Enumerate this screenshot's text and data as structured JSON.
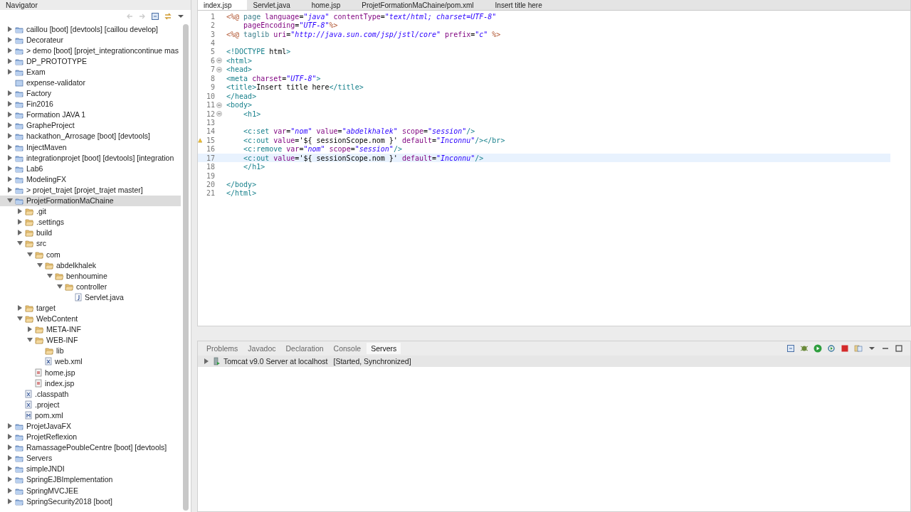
{
  "navigator": {
    "title": "Navigator",
    "tree": [
      {
        "label": "caillou [boot] [devtools] [caillou develop]",
        "kind": "project",
        "expanded": false,
        "selected": false
      },
      {
        "label": "Decorateur",
        "kind": "project",
        "expanded": false,
        "selected": false
      },
      {
        "label": "> demo [boot] [projet_integrationcontinue mas",
        "kind": "project",
        "expanded": false,
        "selected": false
      },
      {
        "label": "DP_PROTOTYPE",
        "kind": "project",
        "expanded": false,
        "selected": false
      },
      {
        "label": "Exam",
        "kind": "project",
        "expanded": false,
        "selected": false
      },
      {
        "label": "expense-validator",
        "kind": "closed",
        "selected": false
      },
      {
        "label": "Factory",
        "kind": "project",
        "expanded": false,
        "selected": false
      },
      {
        "label": "Fin2016",
        "kind": "project",
        "expanded": false,
        "selected": false
      },
      {
        "label": "Formation JAVA 1",
        "kind": "project",
        "expanded": false,
        "selected": false
      },
      {
        "label": "GrapheProject",
        "kind": "project",
        "expanded": false,
        "selected": false
      },
      {
        "label": "hackathon_Arrosage [boot] [devtools]",
        "kind": "project",
        "expanded": false,
        "selected": false
      },
      {
        "label": "InjectMaven",
        "kind": "project",
        "expanded": false,
        "selected": false
      },
      {
        "label": "integrationprojet [boot] [devtools] [integration",
        "kind": "project",
        "expanded": false,
        "selected": false
      },
      {
        "label": "Lab6",
        "kind": "project",
        "expanded": false,
        "selected": false
      },
      {
        "label": "ModelingFX",
        "kind": "project",
        "expanded": false,
        "selected": false
      },
      {
        "label": "> projet_trajet [projet_trajet master]",
        "kind": "project",
        "expanded": false,
        "selected": false
      },
      {
        "label": "ProjetFormationMaChaine",
        "kind": "project",
        "expanded": true,
        "selected": true,
        "children": [
          {
            "label": ".git",
            "kind": "folder",
            "expanded": false,
            "selected": false
          },
          {
            "label": ".settings",
            "kind": "folder",
            "expanded": false,
            "selected": false
          },
          {
            "label": "build",
            "kind": "folder",
            "expanded": false,
            "selected": false
          },
          {
            "label": "src",
            "kind": "folder",
            "expanded": true,
            "selected": false,
            "children": [
              {
                "label": "com",
                "kind": "folder",
                "expanded": true,
                "selected": false,
                "children": [
                  {
                    "label": "abdelkhalek",
                    "kind": "folder",
                    "expanded": true,
                    "selected": false,
                    "children": [
                      {
                        "label": "benhoumine",
                        "kind": "folder",
                        "expanded": true,
                        "selected": false,
                        "children": [
                          {
                            "label": "controller",
                            "kind": "folder",
                            "expanded": true,
                            "selected": false,
                            "children": [
                              {
                                "label": "Servlet.java",
                                "kind": "java",
                                "selected": false
                              }
                            ]
                          }
                        ]
                      }
                    ]
                  }
                ]
              }
            ]
          },
          {
            "label": "target",
            "kind": "folder",
            "expanded": false,
            "selected": false
          },
          {
            "label": "WebContent",
            "kind": "folder",
            "expanded": true,
            "selected": false,
            "children": [
              {
                "label": "META-INF",
                "kind": "folder",
                "expanded": false,
                "selected": false
              },
              {
                "label": "WEB-INF",
                "kind": "folder",
                "expanded": true,
                "selected": false,
                "children": [
                  {
                    "label": "lib",
                    "kind": "folder",
                    "selected": false
                  },
                  {
                    "label": "web.xml",
                    "kind": "xml",
                    "selected": false
                  }
                ]
              },
              {
                "label": "home.jsp",
                "kind": "jsp",
                "selected": false
              },
              {
                "label": "index.jsp",
                "kind": "jsp",
                "selected": false
              }
            ]
          },
          {
            "label": ".classpath",
            "kind": "xml",
            "selected": false
          },
          {
            "label": ".project",
            "kind": "xml",
            "selected": false
          },
          {
            "label": "pom.xml",
            "kind": "maven",
            "selected": false
          }
        ]
      },
      {
        "label": "ProjetJavaFX",
        "kind": "project",
        "expanded": false,
        "selected": false
      },
      {
        "label": "ProjetReflexion",
        "kind": "project",
        "expanded": false,
        "selected": false
      },
      {
        "label": "RamassagePoubleCentre [boot] [devtools]",
        "kind": "project",
        "expanded": false,
        "selected": false
      },
      {
        "label": "Servers",
        "kind": "project",
        "expanded": false,
        "selected": false
      },
      {
        "label": "simpleJNDI",
        "kind": "project",
        "expanded": false,
        "selected": false
      },
      {
        "label": "SpringEJBImplementation",
        "kind": "project",
        "expanded": false,
        "selected": false
      },
      {
        "label": "SpringMVCJEE",
        "kind": "project",
        "expanded": false,
        "selected": false
      },
      {
        "label": "SpringSecurity2018 [boot]",
        "kind": "project",
        "expanded": false,
        "selected": false
      }
    ]
  },
  "editor": {
    "tabs": [
      {
        "label": "index.jsp",
        "selected": true
      },
      {
        "label": "Servlet.java",
        "selected": false
      },
      {
        "label": "home.jsp",
        "selected": false
      },
      {
        "label": "ProjetFormationMaChaine/pom.xml",
        "selected": false
      },
      {
        "label": "Insert title here",
        "selected": false
      }
    ],
    "lines": [
      {
        "number": "1",
        "text": "<%@ page language=\"java\" contentType=\"text/html; charset=UTF-8\""
      },
      {
        "number": "2",
        "text": "    pageEncoding=\"UTF-8\"%>"
      },
      {
        "number": "3",
        "text": "<%@ taglib uri=\"http://java.sun.com/jsp/jstl/core\" prefix=\"c\" %>"
      },
      {
        "number": "4"
      },
      {
        "number": "5",
        "text": "<!DOCTYPE html>"
      },
      {
        "number": "6",
        "fold": true,
        "text": "<html>"
      },
      {
        "number": "7",
        "fold": true,
        "text": "<head>"
      },
      {
        "number": "8",
        "text": "<meta charset=\"UTF-8\">"
      },
      {
        "number": "9",
        "text": "<title>Insert title here</title>"
      },
      {
        "number": "10",
        "text": "</head>"
      },
      {
        "number": "11",
        "fold": true,
        "text": "<body>"
      },
      {
        "number": "12",
        "fold": true,
        "text": "    <h1>"
      },
      {
        "number": "13"
      },
      {
        "number": "14",
        "text": "    <c:set var=\"nom\" value=\"abdelkhalek\" scope=\"session\"/>"
      },
      {
        "number": "15",
        "warning": true,
        "text": "    <c:out value='${ sessionScope.nom }' default=\"Inconnu\"/></br>"
      },
      {
        "number": "16",
        "text": "    <c:remove var=\"nom\" scope=\"session\"/>"
      },
      {
        "number": "17",
        "current": true,
        "text": "    <c:out value='${ sessionScope.nom }' default=\"Inconnu\"/>"
      },
      {
        "number": "18",
        "text": "    </h1>"
      },
      {
        "number": "19"
      },
      {
        "number": "20",
        "text": "</body>"
      },
      {
        "number": "21",
        "text": "</html>"
      }
    ]
  },
  "bottom": {
    "tabs": [
      {
        "label": "Problems",
        "selected": false
      },
      {
        "label": "Javadoc",
        "selected": false
      },
      {
        "label": "Declaration",
        "selected": false
      },
      {
        "label": "Console",
        "selected": false
      },
      {
        "label": "Servers",
        "selected": true
      }
    ],
    "servers": [
      {
        "name": "Tomcat v9.0 Server at localhost",
        "status": "[Started, Synchronized]"
      }
    ]
  }
}
